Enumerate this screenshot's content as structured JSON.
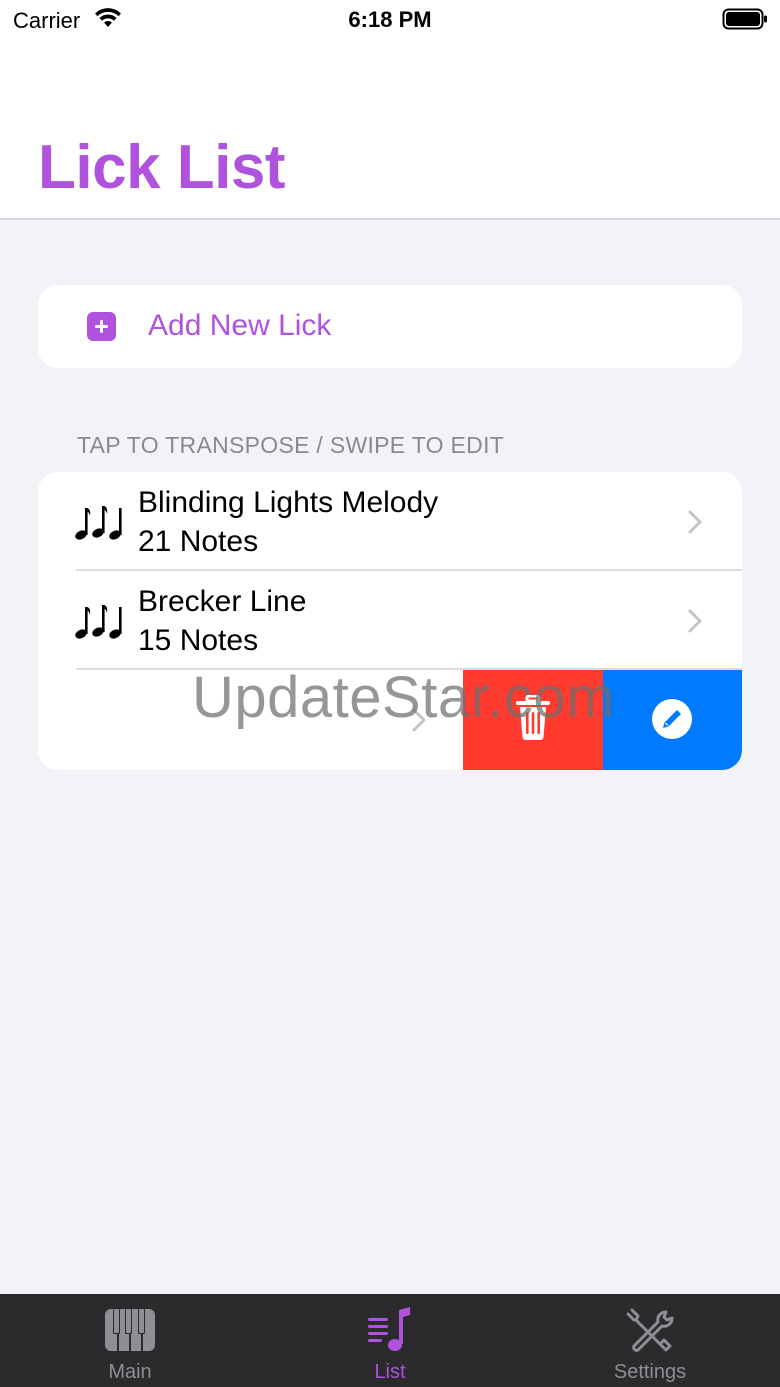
{
  "status_bar": {
    "carrier": "Carrier",
    "time": "6:18 PM"
  },
  "header": {
    "title": "Lick List"
  },
  "add_card": {
    "label": "Add New Lick",
    "icon": "plus-square-icon"
  },
  "section": {
    "header": "TAP TO TRANSPOSE / SWIPE TO EDIT"
  },
  "licks": [
    {
      "title": "Blinding Lights Melody",
      "subtitle": "21 Notes",
      "icon": "music-notes-icon"
    },
    {
      "title": "Brecker Line",
      "subtitle": "15 Notes",
      "icon": "music-notes-icon"
    }
  ],
  "swipe_actions": {
    "delete_icon": "trash-icon",
    "edit_icon": "pencil-icon",
    "delete_color": "#ff3b30",
    "edit_color": "#007aff"
  },
  "watermark": "UpdateStar.com",
  "tab_bar": {
    "tabs": [
      {
        "label": "Main",
        "icon": "piano-keys-icon",
        "active": false
      },
      {
        "label": "List",
        "icon": "music-list-icon",
        "active": true
      },
      {
        "label": "Settings",
        "icon": "tools-icon",
        "active": false
      }
    ]
  },
  "colors": {
    "accent": "#af52de",
    "background": "#f2f2f7",
    "tab_bar": "#2b2b2d"
  }
}
